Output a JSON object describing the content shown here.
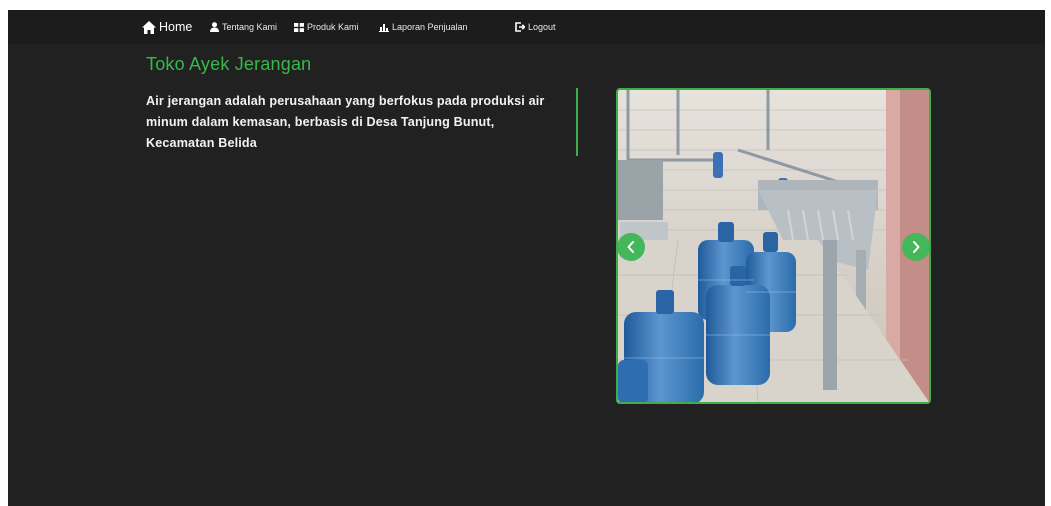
{
  "nav": {
    "items": [
      {
        "label": "Home",
        "icon": "home-icon"
      },
      {
        "label": "Tentang Kami",
        "icon": "user-icon"
      },
      {
        "label": "Produk Kami",
        "icon": "grid-icon"
      },
      {
        "label": "Laporan Penjualan",
        "icon": "bar-chart-icon"
      },
      {
        "label": "Logout",
        "icon": "logout-icon"
      }
    ]
  },
  "brand": {
    "title": "Toko Ayek Jerangan"
  },
  "about": {
    "text": "Air jerangan adalah perusahaan yang berfokus pada produksi air minum dalam kemasan, berbasis di Desa Tanjung Bunut, Kecamatan Belida"
  },
  "carousel": {
    "prev_icon": "chevron-left-icon",
    "next_icon": "chevron-right-icon"
  },
  "colors": {
    "background": "#212121",
    "navbar": "#1c1c1c",
    "accent": "#36b94a",
    "text": "#f2f2f2"
  }
}
